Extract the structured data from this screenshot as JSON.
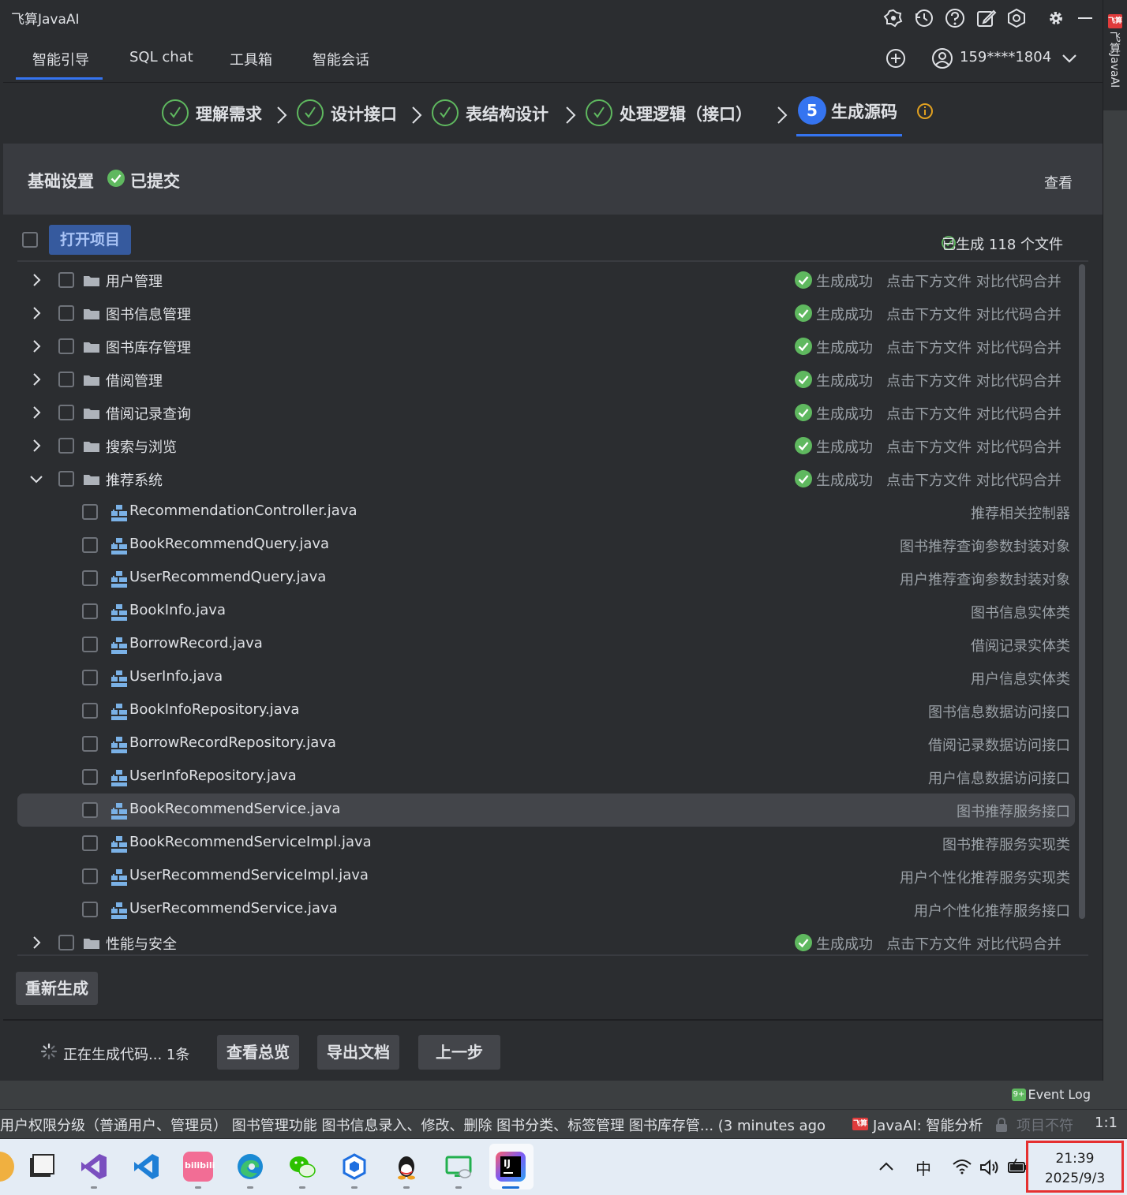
{
  "app_title": "飞算JavaAI",
  "tabs": [
    {
      "label": "智能引导",
      "active": true
    },
    {
      "label": "SQL chat"
    },
    {
      "label": "工具箱"
    },
    {
      "label": "智能会话"
    }
  ],
  "titlebar_icons": [
    "robot-icon",
    "history-icon",
    "help-icon",
    "edit-icon",
    "hexagon-settings-icon",
    "gear-icon",
    "minimize-icon"
  ],
  "user": {
    "name": "159****1804"
  },
  "steps": [
    {
      "label": "理解需求",
      "done": true
    },
    {
      "label": "设计接口",
      "done": true
    },
    {
      "label": "表结构设计",
      "done": true
    },
    {
      "label": "处理逻辑（接口）",
      "done": true
    },
    {
      "number": "5",
      "label": "生成源码",
      "active": true
    }
  ],
  "basic": {
    "title": "基础设置",
    "status": "已提交",
    "view": "查看"
  },
  "toolbar": {
    "open_project": "打开项目",
    "generated": "已生成 118 个文件"
  },
  "rows": [
    {
      "type": "folder",
      "name": "用户管理",
      "status": "生成成功",
      "hint": "点击下方文件 对比代码合并",
      "expanded": false
    },
    {
      "type": "folder",
      "name": "图书信息管理",
      "status": "生成成功",
      "hint": "点击下方文件 对比代码合并",
      "expanded": false
    },
    {
      "type": "folder",
      "name": "图书库存管理",
      "status": "生成成功",
      "hint": "点击下方文件 对比代码合并",
      "expanded": false
    },
    {
      "type": "folder",
      "name": "借阅管理",
      "status": "生成成功",
      "hint": "点击下方文件 对比代码合并",
      "expanded": false
    },
    {
      "type": "folder",
      "name": "借阅记录查询",
      "status": "生成成功",
      "hint": "点击下方文件 对比代码合并",
      "expanded": false
    },
    {
      "type": "folder",
      "name": "搜索与浏览",
      "status": "生成成功",
      "hint": "点击下方文件 对比代码合并",
      "expanded": false
    },
    {
      "type": "folder",
      "name": "推荐系统",
      "status": "生成成功",
      "hint": "点击下方文件 对比代码合并",
      "expanded": true
    },
    {
      "type": "file",
      "name": "RecommendationController.java",
      "desc": "推荐相关控制器"
    },
    {
      "type": "file",
      "name": "BookRecommendQuery.java",
      "desc": "图书推荐查询参数封装对象"
    },
    {
      "type": "file",
      "name": "UserRecommendQuery.java",
      "desc": "用户推荐查询参数封装对象"
    },
    {
      "type": "file",
      "name": "BookInfo.java",
      "desc": "图书信息实体类"
    },
    {
      "type": "file",
      "name": "BorrowRecord.java",
      "desc": "借阅记录实体类"
    },
    {
      "type": "file",
      "name": "UserInfo.java",
      "desc": "用户信息实体类"
    },
    {
      "type": "file",
      "name": "BookInfoRepository.java",
      "desc": "图书信息数据访问接口"
    },
    {
      "type": "file",
      "name": "BorrowRecordRepository.java",
      "desc": "借阅记录数据访问接口"
    },
    {
      "type": "file",
      "name": "UserInfoRepository.java",
      "desc": "用户信息数据访问接口"
    },
    {
      "type": "file",
      "name": "BookRecommendService.java",
      "desc": "图书推荐服务接口",
      "selected": true
    },
    {
      "type": "file",
      "name": "BookRecommendServiceImpl.java",
      "desc": "图书推荐服务实现类"
    },
    {
      "type": "file",
      "name": "UserRecommendServiceImpl.java",
      "desc": "用户个性化推荐服务实现类"
    },
    {
      "type": "file",
      "name": "UserRecommendService.java",
      "desc": "用户个性化推荐服务接口"
    },
    {
      "type": "folder",
      "name": "性能与安全",
      "status": "生成成功",
      "hint": "点击下方文件 对比代码合并",
      "expanded": false
    }
  ],
  "regen_label": "重新生成",
  "bottom": {
    "status": "正在生成代码... 1条",
    "overview": "查看总览",
    "export": "导出文档",
    "prev": "上一步"
  },
  "strip": {
    "logo": "飞算",
    "label": "飞算JavaAI"
  },
  "event_log": {
    "badge": "9+",
    "label": "Event Log"
  },
  "statusbar": {
    "message": "用户权限分级（普通用户、管理员） 图书管理功能 图书信息录入、修改、删除 图书分类、标签管理 图书库存管... (3 minutes ago",
    "logo": "飞算",
    "plugin": "JavaAI: 智能分析",
    "project": "项目不符",
    "position": "1:1"
  },
  "taskbar": {
    "apps": [
      "file-manager-icon",
      "visual-studio-icon",
      "vscode-icon",
      "bilibili-icon",
      "edge-icon",
      "wechat-icon",
      "feishu-icon",
      "qq-icon",
      "remote-desktop-icon",
      "intellij-icon"
    ],
    "bilibili_text": "bilibili",
    "intellij_text": "IJ",
    "tray_ime": "中",
    "time": "21:39",
    "date": "2025/9/3"
  },
  "colors": {
    "accent": "#3574f0",
    "success": "#5fb85f",
    "panel": "#2b2d30",
    "highlight": "#e53030"
  }
}
